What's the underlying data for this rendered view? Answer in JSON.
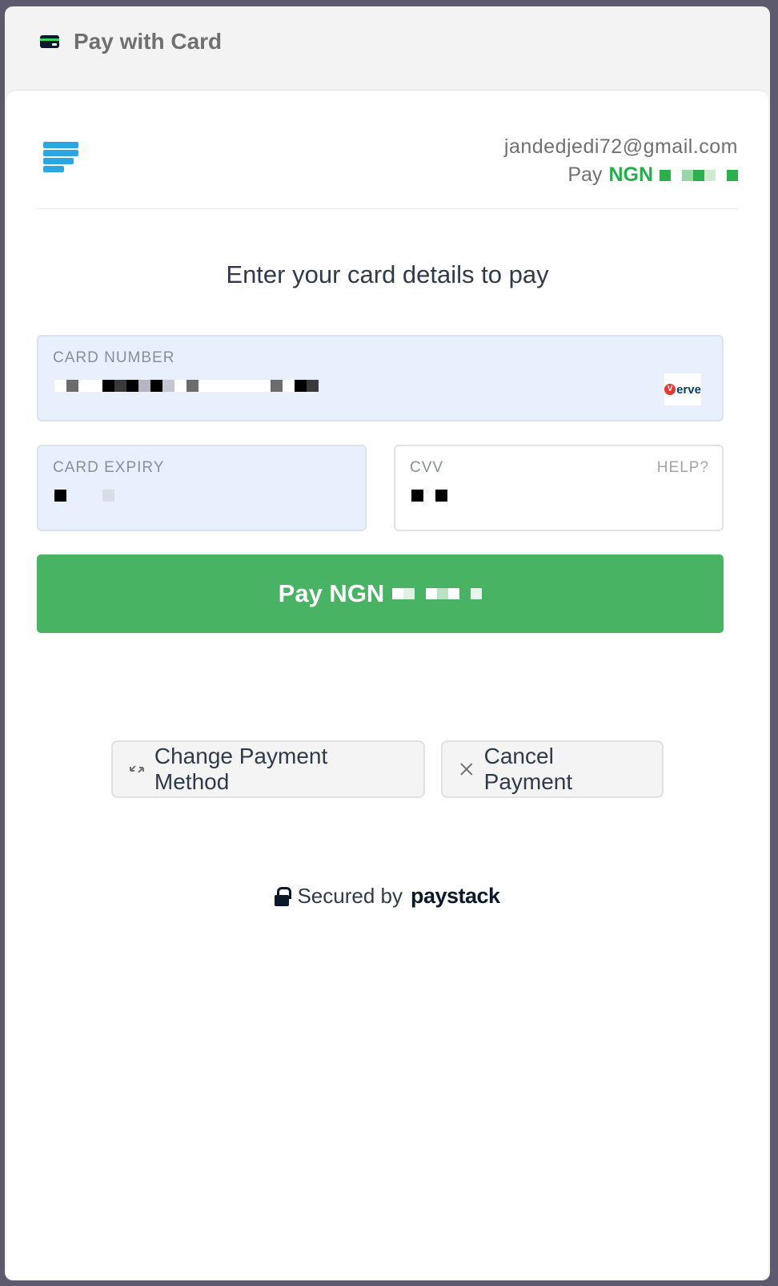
{
  "header": {
    "title": "Pay with Card",
    "icon": "card-icon"
  },
  "merchant": {
    "email": "jandedjedi72@gmail.com",
    "pay_prefix": "Pay",
    "currency": "NGN",
    "amount_masked_colors": [
      "#2bb04d",
      "#ffffff",
      "#9bd6a9",
      "#2bb04d",
      "#cfeccf",
      "#ffffff",
      "#2bb04d"
    ]
  },
  "prompt": "Enter your card details to pay",
  "card_number": {
    "label": "CARD NUMBER",
    "masked_colors": [
      "#ffffff",
      "#6c6c6c",
      "#ffffff",
      "#ffffff",
      "#000000",
      "#3a3a3a",
      "#000000",
      "#b4b4c2",
      "#000000",
      "#c3c7d1",
      "#ffffff",
      "#6c6c6c",
      "#ffffff",
      "#ffffff",
      "#ffffff",
      "#ffffff",
      "#ffffff",
      "#ffffff",
      "#6c6c6c",
      "#ffffff",
      "#000000",
      "#3a3a3a"
    ],
    "brand": "Verve",
    "brand_icon": "verve-logo-icon"
  },
  "card_expiry": {
    "label": "CARD EXPIRY",
    "masked_colors": [
      "#000000",
      "#e7f0fc",
      "#e7f0fc",
      "#e7f0fc",
      "#d8dde6"
    ]
  },
  "cvv": {
    "label": "CVV",
    "help": "HELP?",
    "masked_colors": [
      "#000000",
      "#ffffff",
      "#000000"
    ]
  },
  "pay_button": {
    "label": "Pay NGN",
    "masked_colors": [
      "#ffffff",
      "#e0f1e4",
      "#47b363",
      "#ffffff",
      "#b8e2c2",
      "#ffffff",
      "#47b363",
      "#e8f5ec"
    ]
  },
  "actions": {
    "change_label": "Change Payment Method",
    "cancel_label": "Cancel Payment"
  },
  "footer": {
    "secured_label": "Secured by",
    "brand": "paystack"
  },
  "colors": {
    "accent_green": "#47b363",
    "brand_blue": "#2aa7e0",
    "field_bg": "#e7f0fc"
  }
}
